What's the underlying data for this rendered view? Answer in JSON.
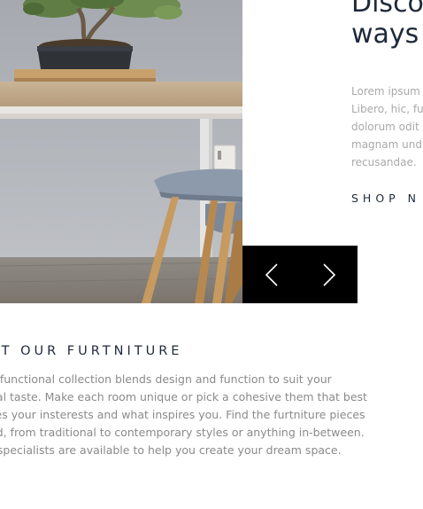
{
  "hero": {
    "headline_line1": "Disco",
    "headline_line2": "ways",
    "body_lines": [
      "Lorem ipsum",
      "Libero, hic, fu",
      "dolorum odit",
      "magnam und",
      "recusandae."
    ],
    "shop_link": "SHOP N",
    "photo_alt": "Bonsai on wooden table with chair"
  },
  "slider": {
    "prev_icon": "chevron-left-icon",
    "next_icon": "chevron-right-icon",
    "background": "#000000",
    "arrow_color": "#ffffff"
  },
  "about": {
    "heading": "UT OUR FURTNITURE",
    "body_lines": [
      "ltifunctional collection blends design and function to suit your",
      "ual taste. Make each room unique or pick a cohesive them that best",
      "ses your insterests and what inspires you. Find the furtniture pieces",
      "ed, from traditional to contemporary styles or anything in-between.",
      "t specialists are available to help you create your dream space."
    ]
  },
  "colors": {
    "heading": "#1e2a3a",
    "muted_text": "#a9a9a9",
    "body_text": "#8a8a8a"
  }
}
